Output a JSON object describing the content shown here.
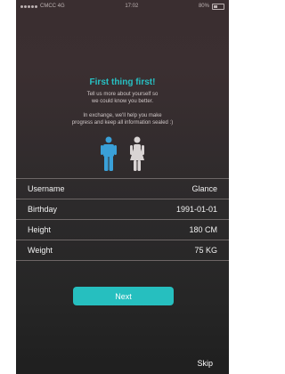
{
  "status": {
    "carrier": "CMCC 4G",
    "time": "17:02",
    "battery": "80%"
  },
  "intro": {
    "title": "First thing first!",
    "line1": "Tell us more about yourself so",
    "line2": "we could know you better.",
    "line3": "In exchange, we'll help you make",
    "line4": "progress and keep all information sealed :)"
  },
  "gender": {
    "male_color": "#3aa0d8",
    "female_color": "#d9d4d4"
  },
  "form": {
    "rows": [
      {
        "label": "Username",
        "value": "Glance"
      },
      {
        "label": "Birthday",
        "value": "1991-01-01"
      },
      {
        "label": "Height",
        "value": "180 CM"
      },
      {
        "label": "Weight",
        "value": "75 KG"
      }
    ]
  },
  "actions": {
    "next_label": "Next",
    "skip_label": "Skip"
  }
}
